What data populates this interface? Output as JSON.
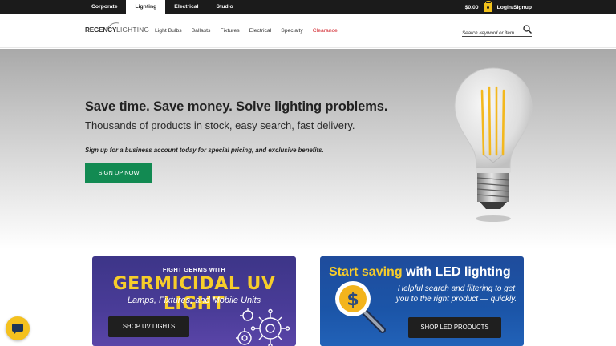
{
  "topbar": {
    "tabs": [
      {
        "label": "Corporate"
      },
      {
        "label": "Lighting"
      },
      {
        "label": "Electrical"
      },
      {
        "label": "Studio"
      }
    ],
    "cart_total": "$0.00",
    "login_label": "Login/Signup"
  },
  "nav": {
    "logo_part1": "REGENCY",
    "logo_part2": "LIGHTING",
    "menu": [
      {
        "label": "Light Bulbs"
      },
      {
        "label": "Ballasts"
      },
      {
        "label": "Fixtures"
      },
      {
        "label": "Electrical"
      },
      {
        "label": "Specialty"
      },
      {
        "label": "Clearance"
      }
    ],
    "search_placeholder": "Search keyword or item"
  },
  "hero": {
    "headline": "Save time. Save money. Solve lighting problems.",
    "subheadline": "Thousands of products in stock, easy search, fast delivery.",
    "note": "Sign up for a business account today for special pricing, and exclusive benefits.",
    "cta_label": "SIGN UP NOW"
  },
  "promo_uv": {
    "line1": "FIGHT GERMS WITH",
    "line2": "GERMICIDAL UV LIGHT",
    "line3": "Lamps, Fixtures, and Mobile Units",
    "button_label": "SHOP UV LIGHTS"
  },
  "promo_led": {
    "title_a": "Start saving ",
    "title_b": "with LED lighting",
    "text": "Helpful search and filtering to get you to the right product — quickly.",
    "button_label": "SHOP LED PRODUCTS"
  },
  "colors": {
    "accent_green": "#128a52",
    "clearance_red": "#d2232a",
    "promo_yellow": "#f7cd2a",
    "chat_yellow": "#f4c11e"
  },
  "icons": {
    "cart": "shopping-bag-icon",
    "search": "search-icon",
    "chat": "chat-icon"
  }
}
